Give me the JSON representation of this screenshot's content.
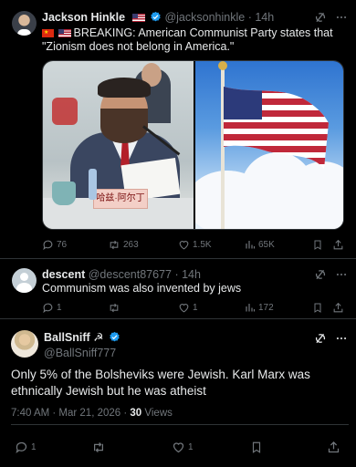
{
  "tweet1": {
    "name": "Jackson Hinkle",
    "handle": "@jacksonhinkle",
    "time": "14h",
    "text_line1": "BREAKING: American Communist Party states that",
    "text_line2": "\"Zionism does not belong in America.\"",
    "placard_text": "哈兹·阿尔丁",
    "stats": {
      "replies": "76",
      "reposts": "263",
      "likes": "1.5K",
      "views": "65K"
    }
  },
  "tweet2": {
    "name": "descent",
    "handle": "@descent87677",
    "time": "14h",
    "text": "Communism was also invented by  jews",
    "stats": {
      "replies": "1",
      "likes": "1",
      "views": "172"
    }
  },
  "tweet3": {
    "name": "BallSniff",
    "name_emoji": "☭",
    "handle": "@BallSniff777",
    "text_line1": "Only 5% of the Bolsheviks were Jewish. Karl Marx was",
    "text_line2": "ethnically Jewish but he was atheist",
    "timestamp": "7:40 AM · Mar 21, 2026 · ",
    "views_count": "30",
    "views_label": "Views",
    "stats": {
      "replies": "1",
      "likes": "1"
    }
  },
  "colors": {
    "background": "#000000",
    "text": "#e7e9ea",
    "muted": "#71767b",
    "verified": "#1d9bf0",
    "border": "#2f3336"
  }
}
